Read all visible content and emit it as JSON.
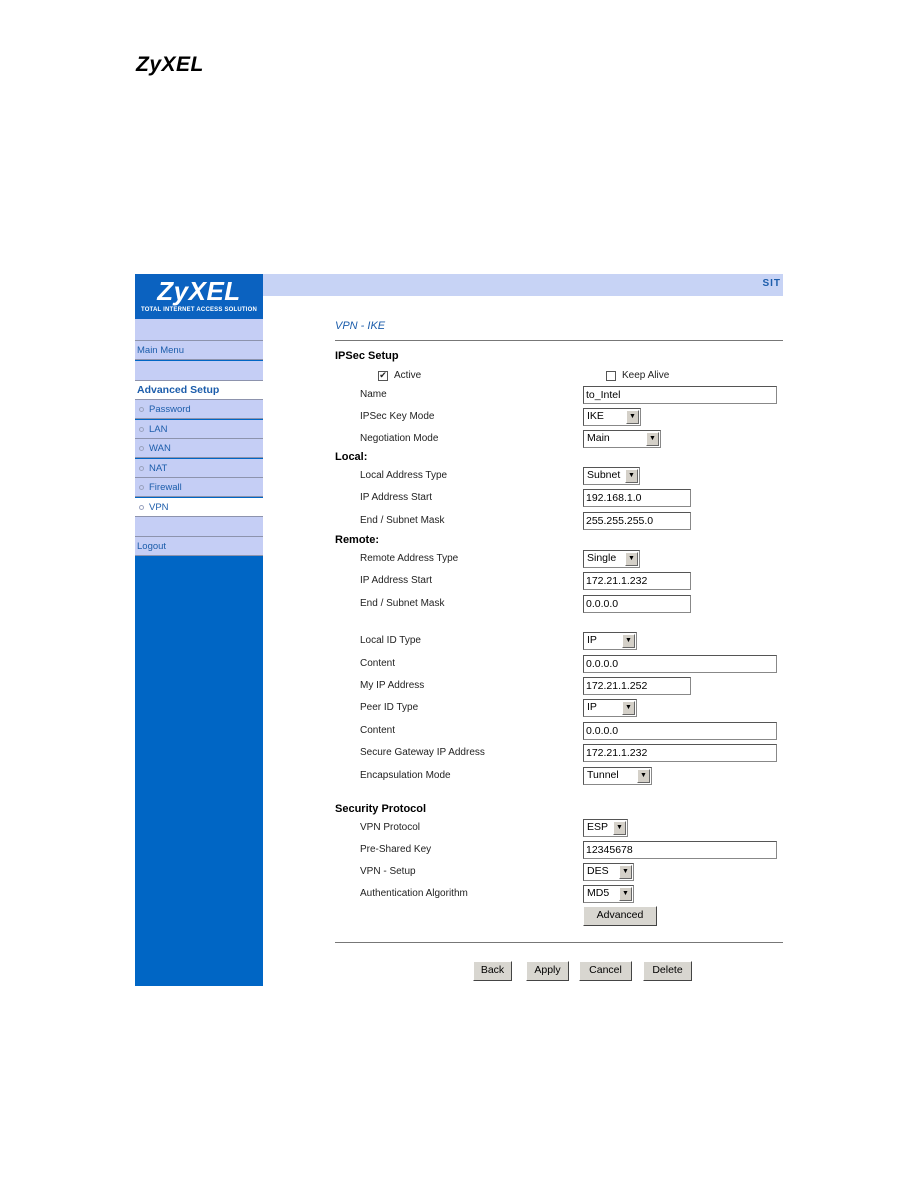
{
  "doc_header": {
    "logo": "ZyXEL"
  },
  "sidebar": {
    "brand": "ZyXEL",
    "tagline": "TOTAL INTERNET ACCESS SOLUTION",
    "main_menu": "Main Menu",
    "advanced_setup": "Advanced Setup",
    "items": [
      {
        "label": "Password"
      },
      {
        "label": "LAN"
      },
      {
        "label": "WAN"
      },
      {
        "label": "NAT"
      },
      {
        "label": "Firewall"
      },
      {
        "label": "VPN",
        "active": true
      }
    ],
    "logout": "Logout"
  },
  "topbar": {
    "text": "SIT"
  },
  "page": {
    "title": "VPN - IKE",
    "ipsec": {
      "heading": "IPSec Setup",
      "active_label": "Active",
      "active_checked": true,
      "keep_alive_label": "Keep Alive",
      "keep_alive_checked": false,
      "name_label": "Name",
      "name_value": "to_Intel",
      "key_mode_label": "IPSec Key Mode",
      "key_mode_value": "IKE",
      "negotiation_label": "Negotiation Mode",
      "negotiation_value": "Main"
    },
    "local": {
      "heading": "Local:",
      "addr_type_label": "Local Address Type",
      "addr_type_value": "Subnet",
      "ip_start_label": "IP Address Start",
      "ip_start_value": "192.168.1.0",
      "end_mask_label": "End / Subnet Mask",
      "end_mask_value": "255.255.255.0"
    },
    "remote": {
      "heading": "Remote:",
      "addr_type_label": "Remote Address Type",
      "addr_type_value": "Single",
      "ip_start_label": "IP Address Start",
      "ip_start_value": "172.21.1.232",
      "end_mask_label": "End / Subnet Mask",
      "end_mask_value": "0.0.0.0"
    },
    "identity": {
      "local_id_type_label": "Local ID Type",
      "local_id_type_value": "IP",
      "local_content_label": "Content",
      "local_content_value": "0.0.0.0",
      "my_ip_label": "My IP Address",
      "my_ip_value": "172.21.1.252",
      "peer_id_type_label": "Peer ID Type",
      "peer_id_type_value": "IP",
      "peer_content_label": "Content",
      "peer_content_value": "0.0.0.0",
      "gateway_label": "Secure Gateway IP Address",
      "gateway_value": "172.21.1.232",
      "encap_label": "Encapsulation Mode",
      "encap_value": "Tunnel"
    },
    "security": {
      "heading": "Security Protocol",
      "protocol_label": "VPN Protocol",
      "protocol_value": "ESP",
      "psk_label": "Pre-Shared Key",
      "psk_value": "12345678",
      "setup_label": "VPN - Setup",
      "setup_value": "DES",
      "auth_label": "Authentication Algorithm",
      "auth_value": "MD5",
      "advanced_button": "Advanced"
    },
    "actions": {
      "back": "Back",
      "apply": "Apply",
      "cancel": "Cancel",
      "delete": "Delete"
    }
  }
}
